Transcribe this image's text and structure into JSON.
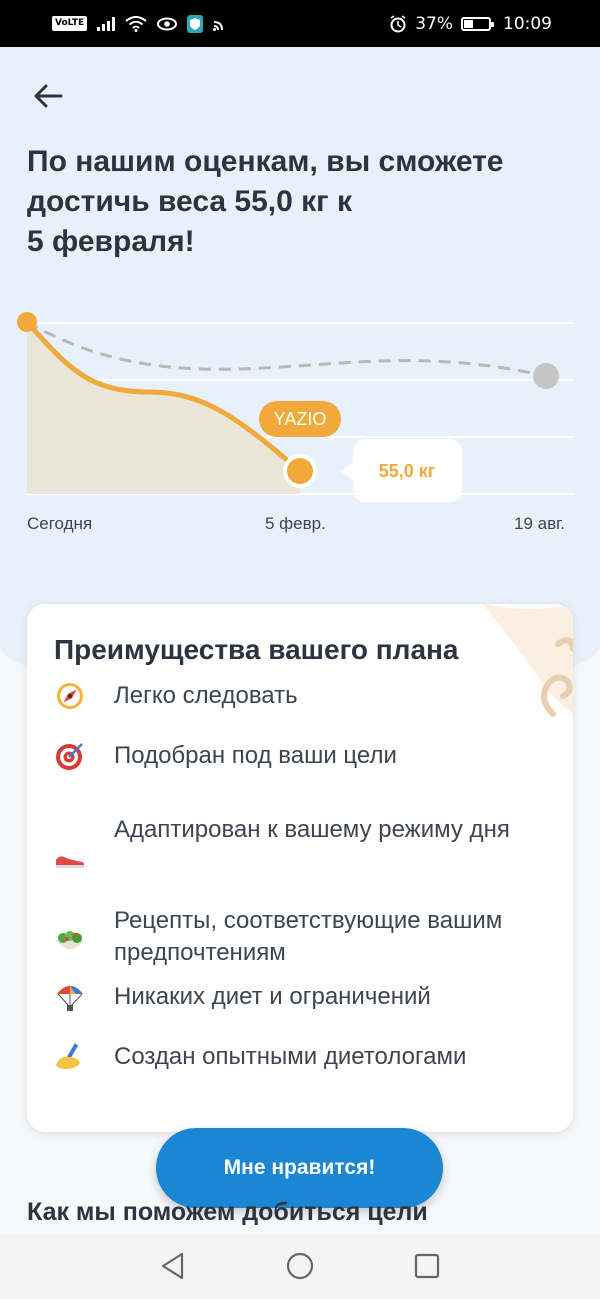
{
  "status_bar": {
    "volte": "VoLTE",
    "battery_pct": "37%",
    "time": "10:09",
    "battery_level": 0.37
  },
  "headline": {
    "line1": "По нашим оценкам, вы сможете",
    "line2": "достичь веса 55,0 кг к",
    "line3": "5 февраля!"
  },
  "chart_data": {
    "type": "line",
    "x": [
      "Сегодня",
      "5 февр.",
      "19 авг."
    ],
    "tooltip_value": "55,0 кг",
    "brand_tag": "YAZIO",
    "series": [
      {
        "color": "#f2a93b",
        "style": "solid"
      },
      {
        "color": "#b8b8b8",
        "style": "dashed"
      }
    ]
  },
  "card": {
    "title": "Преимущества вашего плана",
    "benefits": [
      {
        "icon": "compass-icon",
        "text": "Легко следовать"
      },
      {
        "icon": "target-icon",
        "text": "Подобран под ваши цели"
      },
      {
        "icon": "sneaker-icon",
        "text": "Адаптирован к вашему режиму дня"
      },
      {
        "icon": "salad-icon",
        "text": "Рецепты, соответствующие вашим предпочтениям"
      },
      {
        "icon": "parachute-icon",
        "text": "Никаких диет и ограничений"
      },
      {
        "icon": "writing-hand-icon",
        "text": "Создан опытными диетологами"
      }
    ]
  },
  "cta_label": "Мне нравится!",
  "next_section_title": "Как мы поможем добиться цели",
  "colors": {
    "accent": "#f2a93b",
    "primary_button": "#1a86d4",
    "hero_bg": "#e8f1f9"
  }
}
